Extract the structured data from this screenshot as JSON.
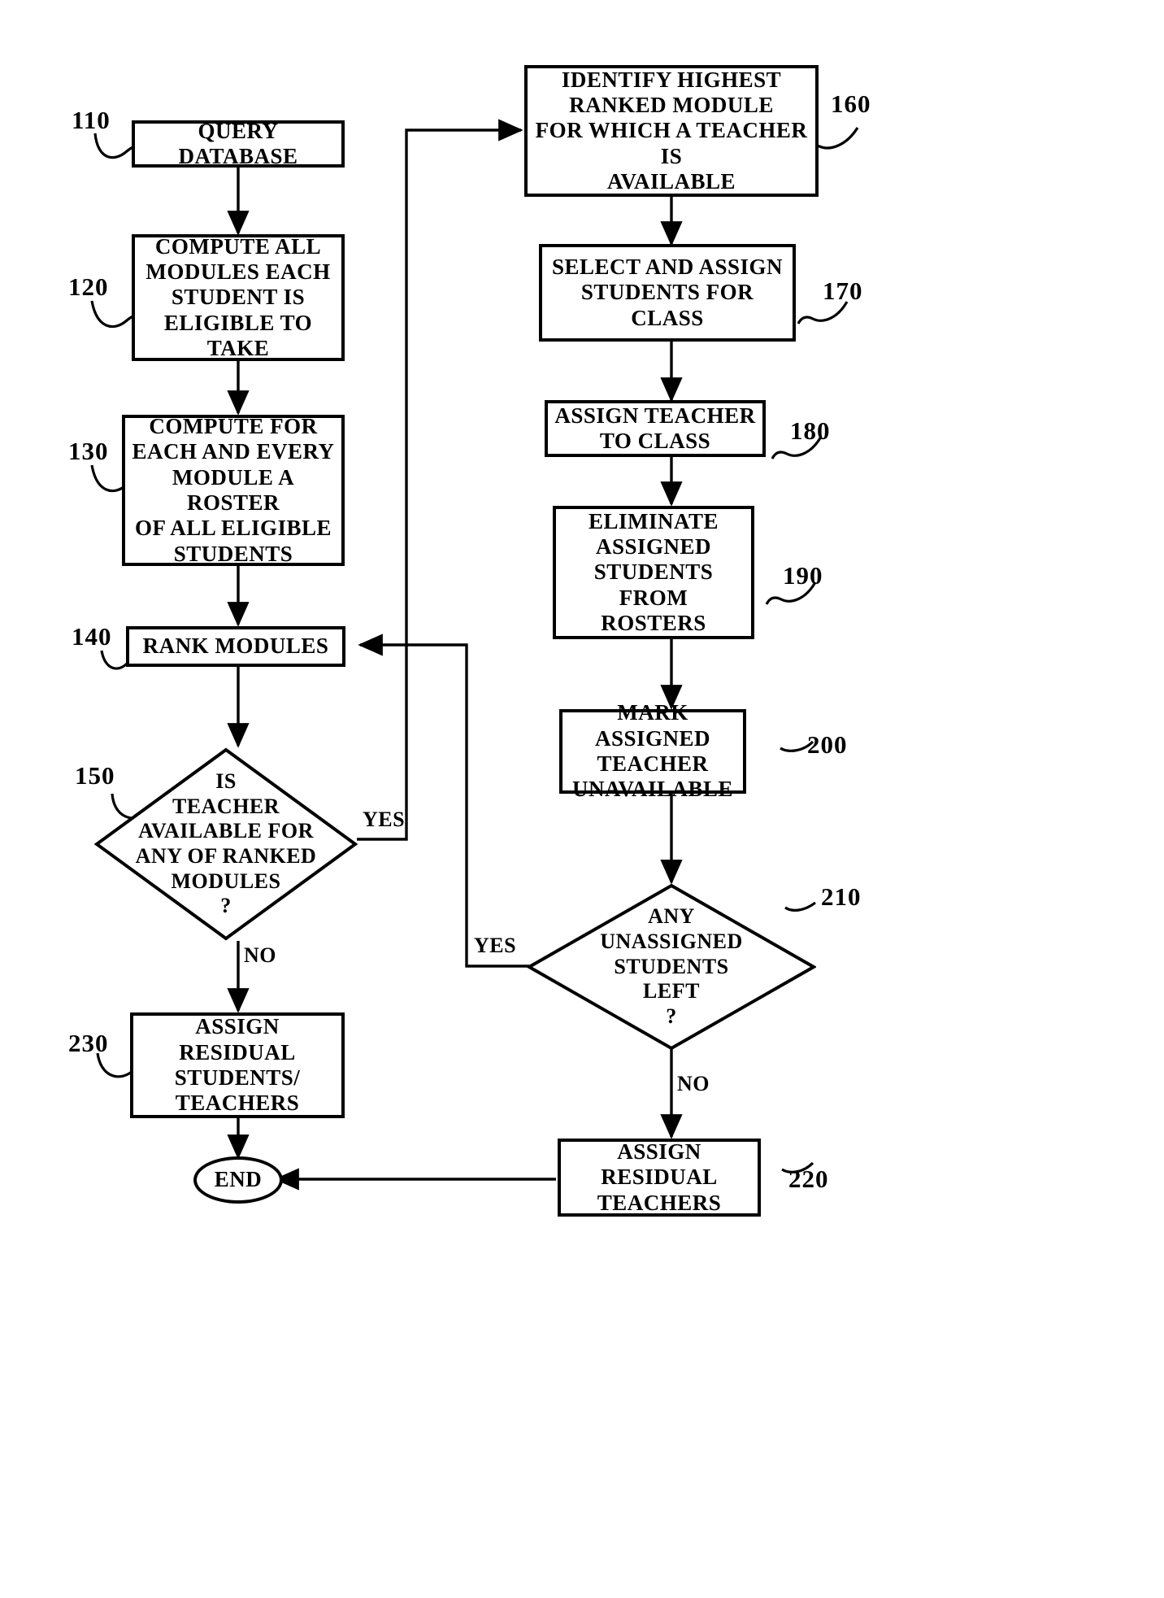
{
  "figure": {
    "kind": "patent-flowchart",
    "ink_color": "#000000",
    "background_color": "#ffffff"
  },
  "nodes": {
    "query_database": {
      "ref": "110",
      "shape": "process",
      "lines": [
        "QUERY DATABASE"
      ]
    },
    "compute_modules": {
      "ref": "120",
      "shape": "process",
      "lines": [
        "COMPUTE ALL",
        "MODULES EACH",
        "STUDENT IS",
        "ELIGIBLE TO TAKE"
      ]
    },
    "compute_roster": {
      "ref": "130",
      "shape": "process",
      "lines": [
        "COMPUTE FOR",
        "EACH AND EVERY",
        "MODULE A ROSTER",
        "OF ALL ELIGIBLE",
        "STUDENTS"
      ]
    },
    "rank_modules": {
      "ref": "140",
      "shape": "process",
      "lines": [
        "RANK MODULES"
      ]
    },
    "teacher_available": {
      "ref": "150",
      "shape": "decision",
      "lines": [
        "IS",
        "TEACHER",
        "AVAILABLE FOR",
        "ANY OF RANKED",
        "MODULES",
        "?"
      ]
    },
    "identify_highest": {
      "ref": "160",
      "shape": "process",
      "lines": [
        "IDENTIFY HIGHEST",
        "RANKED MODULE",
        "FOR WHICH A TEACHER IS",
        "AVAILABLE"
      ]
    },
    "select_assign_students": {
      "ref": "170",
      "shape": "process",
      "lines": [
        "SELECT AND ASSIGN",
        "STUDENTS FOR",
        "CLASS"
      ]
    },
    "assign_teacher": {
      "ref": "180",
      "shape": "process",
      "lines": [
        "ASSIGN TEACHER",
        "TO CLASS"
      ]
    },
    "eliminate_students": {
      "ref": "190",
      "shape": "process",
      "lines": [
        "ELIMINATE",
        "ASSIGNED",
        "STUDENTS FROM",
        "ROSTERS"
      ]
    },
    "mark_teacher": {
      "ref": "200",
      "shape": "process",
      "lines": [
        "MARK ASSIGNED",
        "TEACHER",
        "UNAVAILABLE"
      ]
    },
    "unassigned_students": {
      "ref": "210",
      "shape": "decision",
      "lines": [
        "ANY",
        "UNASSIGNED",
        "STUDENTS",
        "LEFT",
        "?"
      ]
    },
    "assign_residual_teachers": {
      "ref": "220",
      "shape": "process",
      "lines": [
        "ASSIGN RESIDUAL",
        "TEACHERS"
      ]
    },
    "assign_residual_students_teachers": {
      "ref": "230",
      "shape": "process",
      "lines": [
        "ASSIGN RESIDUAL",
        "STUDENTS/",
        "TEACHERS"
      ]
    },
    "end": {
      "ref": "",
      "shape": "terminator",
      "lines": [
        "END"
      ]
    }
  },
  "edge_labels": {
    "yes_left": "YES",
    "no_left": "NO",
    "yes_right": "YES",
    "no_right": "NO"
  }
}
